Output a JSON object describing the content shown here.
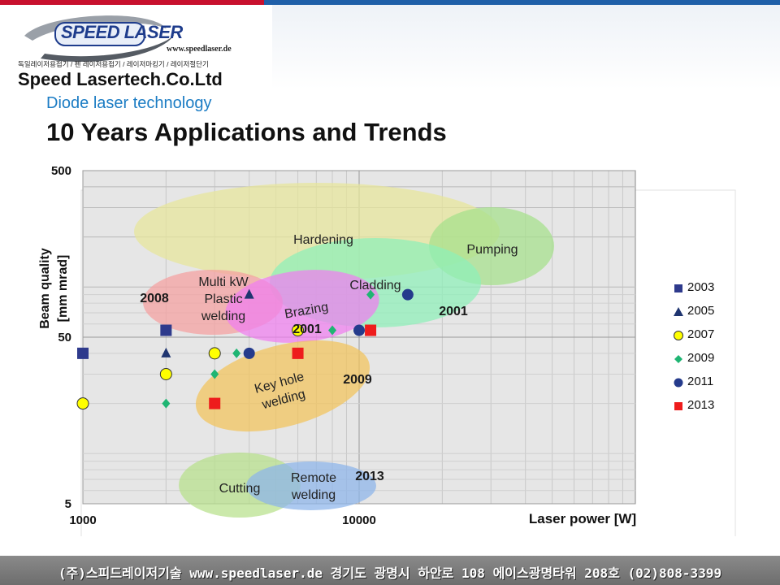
{
  "header": {
    "logo_badge": "SPEED LASER",
    "logo_url": "www.speedlaser.de",
    "logo_products": "독일레이저용접기 / 펜 레이저용접기 / 레이저마킹기 / 레이저절단기",
    "company": "Speed Lasertech.Co.Ltd",
    "subtitle": "Diode laser technology",
    "title": "10 Years Applications  and Trends"
  },
  "footer": {
    "text": "(주)스피드레이저기술 www.speedlaser.de  경기도 광명시 하안로 108 에이스광명타워 208호 (02)808-3399"
  },
  "colors": {
    "top_bar_left": "#c8102e",
    "top_bar_right": "#1f5fa8",
    "subtitle": "#1b7cc4"
  },
  "chart_data": {
    "type": "scatter",
    "xlabel": "Laser power [W]",
    "ylabel_line1": "Beam quality",
    "ylabel_line2": "[mm mrad]",
    "x_scale": "log",
    "y_scale": "log",
    "xlim": [
      1000,
      100000
    ],
    "ylim": [
      5,
      500
    ],
    "x_tick_labels": [
      "1000",
      "10000"
    ],
    "y_tick_labels": [
      "5",
      "50",
      "500"
    ],
    "grid": true,
    "legend_position": "right",
    "series": [
      {
        "name": "2003",
        "marker": "square",
        "color": "#2e3a8c",
        "points": [
          [
            1000,
            40
          ],
          [
            2000,
            55
          ]
        ]
      },
      {
        "name": "2005",
        "marker": "triangle",
        "color": "#1f3570",
        "points": [
          [
            2000,
            40
          ],
          [
            4000,
            90
          ]
        ]
      },
      {
        "name": "2007",
        "marker": "circle",
        "color": "#ffff00",
        "points": [
          [
            1000,
            20
          ],
          [
            2000,
            30
          ],
          [
            3000,
            40
          ],
          [
            6000,
            55
          ]
        ]
      },
      {
        "name": "2009",
        "marker": "diamond",
        "color": "#1fb573",
        "points": [
          [
            2000,
            20
          ],
          [
            3000,
            30
          ],
          [
            3600,
            40
          ],
          [
            8000,
            55
          ],
          [
            11000,
            90
          ]
        ]
      },
      {
        "name": "2011",
        "marker": "circle",
        "color": "#253b8c",
        "points": [
          [
            4000,
            40
          ],
          [
            10000,
            55
          ],
          [
            15000,
            90
          ]
        ]
      },
      {
        "name": "2013",
        "marker": "square",
        "color": "#ee1c1c",
        "points": [
          [
            3000,
            20
          ],
          [
            6000,
            40
          ],
          [
            11000,
            55
          ]
        ]
      }
    ],
    "regions": [
      {
        "label": "Hardening",
        "color": "#e8e69a"
      },
      {
        "label": "Pumping",
        "color": "#a5e08a"
      },
      {
        "label": "Cladding",
        "color": "#8ef0b8"
      },
      {
        "label": "Multi kW Plastic welding",
        "color": "#f5a0a0"
      },
      {
        "label": "Brazing",
        "color": "#f07ef0"
      },
      {
        "label": "Key hole welding",
        "color": "#f2c45a"
      },
      {
        "label": "Cutting",
        "color": "#b7e08a"
      },
      {
        "label": "Remote welding",
        "color": "#8cb4ea"
      }
    ],
    "annotations": [
      "2008",
      "2001",
      "2001",
      "2009",
      "2013"
    ]
  }
}
